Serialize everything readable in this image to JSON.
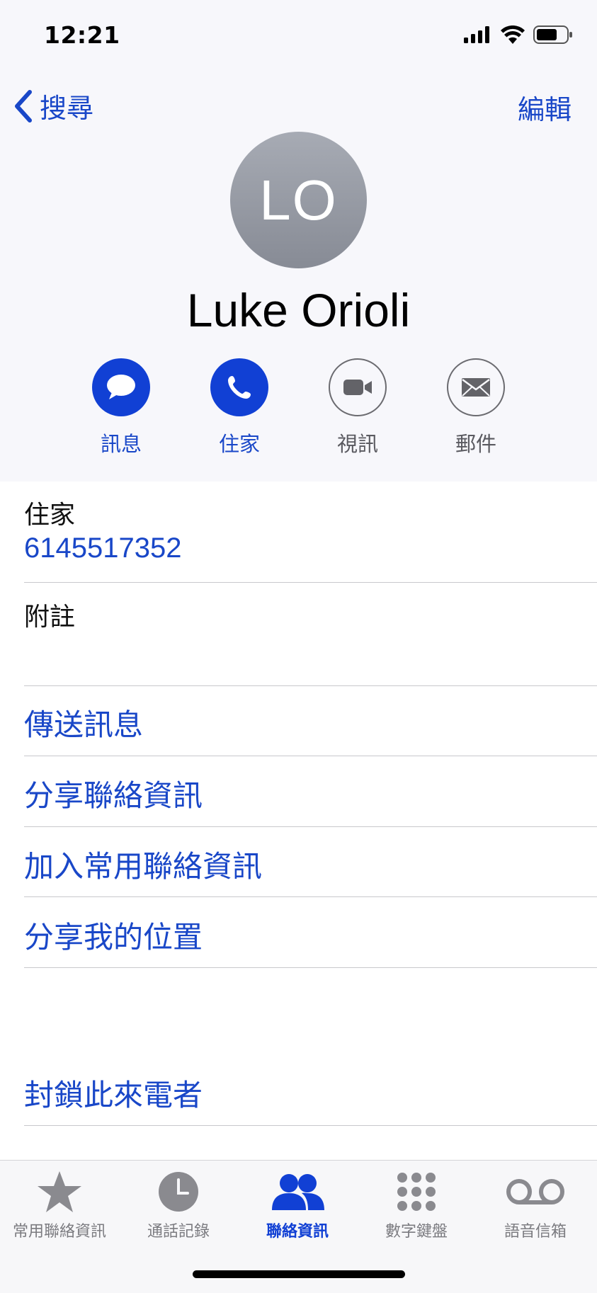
{
  "status_bar": {
    "time": "12:21"
  },
  "nav": {
    "back_label": "搜尋",
    "edit_label": "編輯"
  },
  "contact": {
    "initials": "LO",
    "name": "Luke Orioli"
  },
  "actions": [
    {
      "label": "訊息",
      "icon": "message-bubble-icon",
      "enabled": true
    },
    {
      "label": "住家",
      "icon": "phone-icon",
      "enabled": true
    },
    {
      "label": "視訊",
      "icon": "video-camera-icon",
      "enabled": false
    },
    {
      "label": "郵件",
      "icon": "envelope-icon",
      "enabled": false
    }
  ],
  "phone": {
    "label": "住家",
    "number": "6145517352"
  },
  "notes": {
    "label": "附註"
  },
  "links": [
    {
      "label": "傳送訊息"
    },
    {
      "label": "分享聯絡資訊"
    },
    {
      "label": "加入常用聯絡資訊"
    },
    {
      "label": "分享我的位置"
    },
    {
      "label": "封鎖此來電者"
    }
  ],
  "tabs": [
    {
      "label": "常用聯絡資訊",
      "icon": "star-icon",
      "active": false
    },
    {
      "label": "通話記錄",
      "icon": "clock-icon",
      "active": false
    },
    {
      "label": "聯絡資訊",
      "icon": "contacts-icon",
      "active": true
    },
    {
      "label": "數字鍵盤",
      "icon": "keypad-icon",
      "active": false
    },
    {
      "label": "語音信箱",
      "icon": "voicemail-icon",
      "active": false
    }
  ],
  "colors": {
    "accent": "#1140d4",
    "link": "#1947c8",
    "inactive": "#7b7b80"
  }
}
